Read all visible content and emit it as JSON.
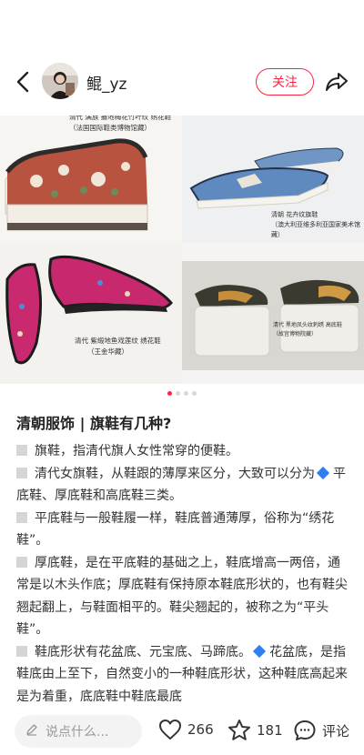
{
  "header": {
    "username": "鲲_yz",
    "follow_label": "关注"
  },
  "images": {
    "panel1": {
      "line1": "清代 满族 撒地梅花竹叶纹 绣花鞋",
      "line2": "（法国国际鞋类博物馆藏）"
    },
    "panel2": {
      "line1": "清朝 花卉纹旗鞋",
      "line2": "（澳大利亚维多利亚国家美术馆藏）"
    },
    "panel3": {
      "line1": "清代 紫缎地鱼戏莲纹 绣花鞋",
      "line2": "（王金华藏）"
    },
    "panel4": {
      "line1": "清代 黑地凤头纹刺绣 高底鞋",
      "line2": "（故宫博物院藏）"
    }
  },
  "carousel": {
    "current_page": 1,
    "total_pages": 4
  },
  "post": {
    "title": "清朝服饰 | 旗鞋有几种?",
    "p1": "旗鞋，指清代旗人女性常穿的便鞋。",
    "p2a": "清代女旗鞋，从鞋跟的薄厚来区分，大致可以分为",
    "p2b": "平底鞋、厚底鞋和高底鞋三类。",
    "p3": "平底鞋与一般鞋履一样，鞋底普通薄厚，俗称为“绣花鞋”。",
    "p4": "厚底鞋，是在平底鞋的基础之上，鞋底增高一两倍，通常是以木头作底；厚底鞋有保持原本鞋底形状的，也有鞋尖翘起翻上，与鞋面相平的。鞋尖翘起的，被称之为“平头鞋”。",
    "p5a": "鞋底形状有花盆底、元宝底、马蹄底。",
    "p5b": "花盆底，是指鞋底由上至下，自然变小的一种鞋底形状，这种鞋底高起来是为着重，底底鞋中鞋底最底"
  },
  "bottom": {
    "comment_placeholder": "说点什么...",
    "likes": "266",
    "stars": "181",
    "comment_label": "评论"
  },
  "colors": {
    "accent": "#ff2442",
    "diamond": "#2f7ff0"
  }
}
